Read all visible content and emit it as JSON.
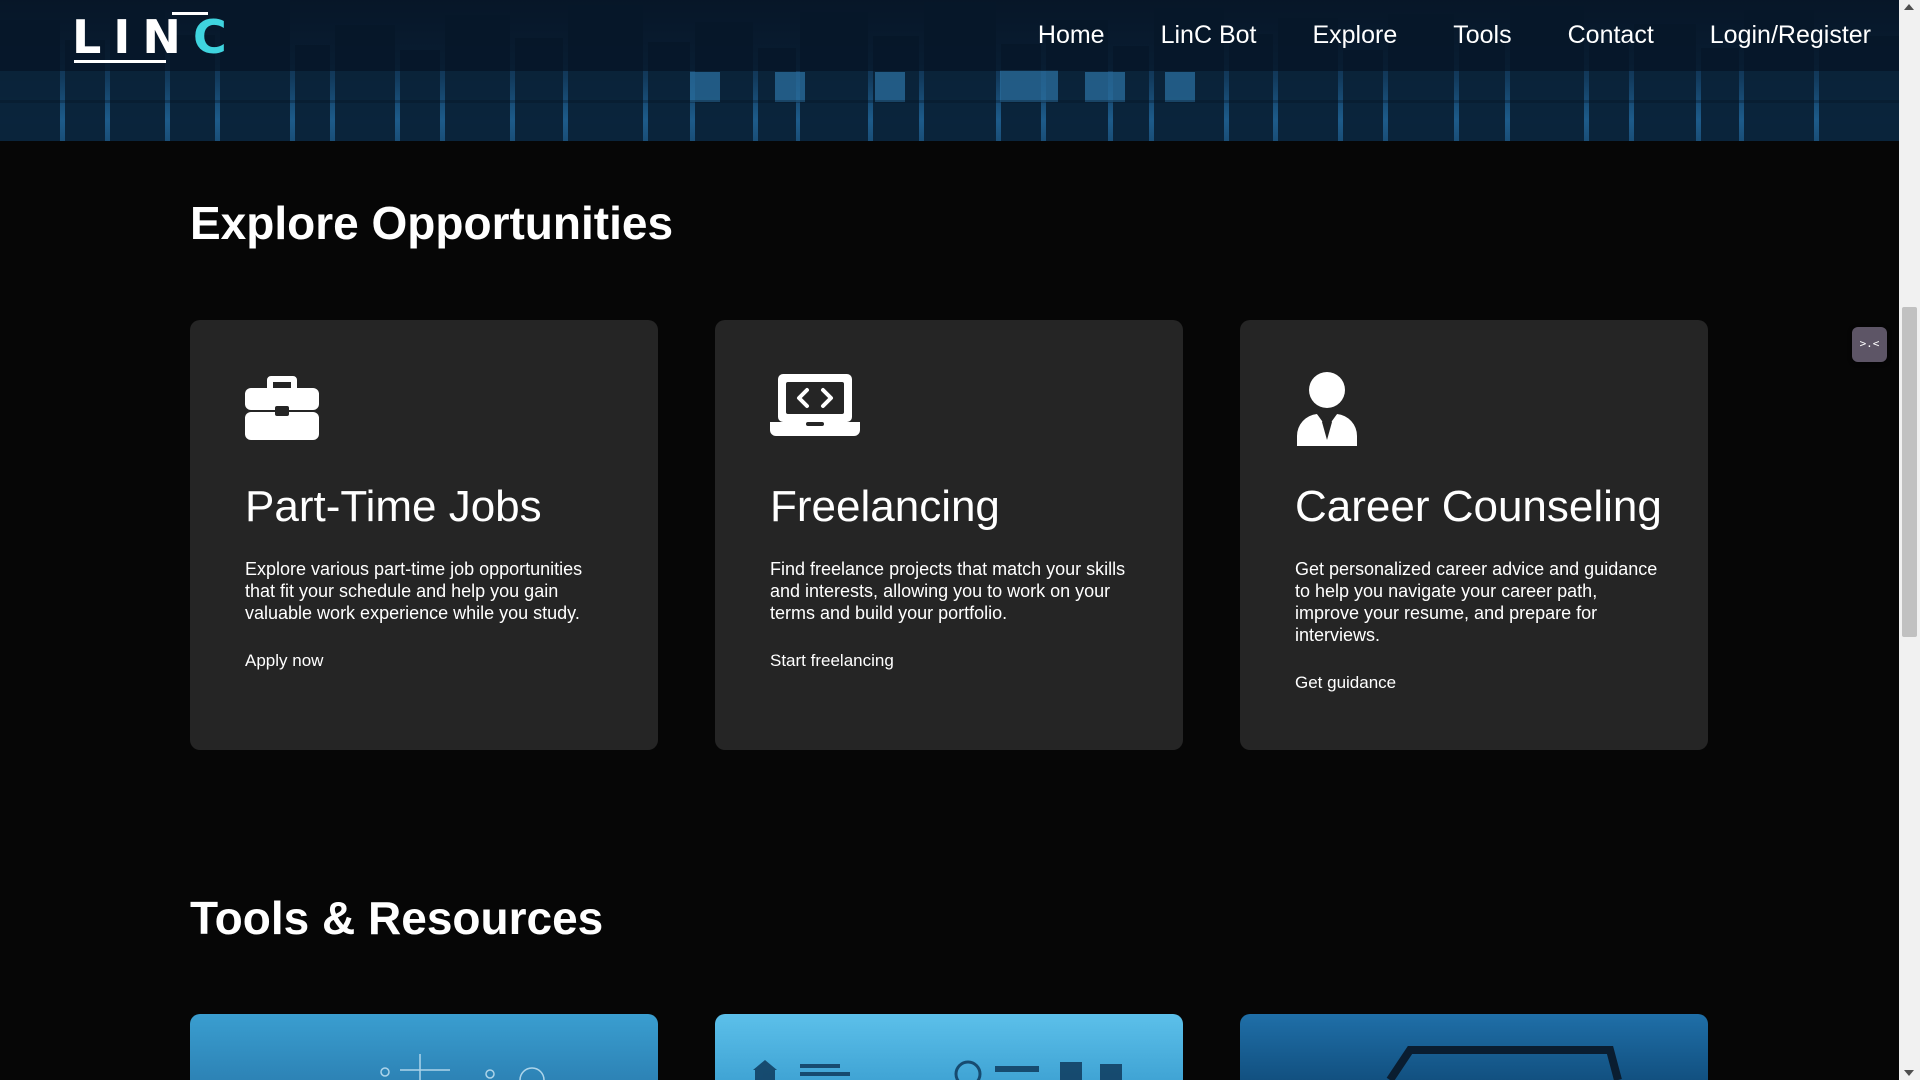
{
  "brand": {
    "logo_text": "LIN",
    "logo_accent": "C",
    "accent_color": "#3fd4df"
  },
  "nav": {
    "items": [
      {
        "label": "Home"
      },
      {
        "label": "LinC Bot"
      },
      {
        "label": "Explore"
      },
      {
        "label": "Tools"
      },
      {
        "label": "Contact"
      },
      {
        "label": "Login/Register"
      }
    ]
  },
  "explore": {
    "title": "Explore Opportunities",
    "cards": [
      {
        "icon": "briefcase-icon",
        "title": "Part-Time Jobs",
        "description": "Explore various part-time job opportunities that fit your schedule and help you gain valuable work experience while you study.",
        "link": "Apply now"
      },
      {
        "icon": "laptop-code-icon",
        "title": "Freelancing",
        "description": "Find freelance projects that match your skills and interests, allowing you to work on your terms and build your portfolio.",
        "link": "Start freelancing"
      },
      {
        "icon": "user-tie-icon",
        "title": "Career Counseling",
        "description": "Get personalized career advice and guidance to help you navigate your career path, improve your resume, and prepare for interviews.",
        "link": "Get guidance"
      }
    ]
  },
  "tools": {
    "title": "Tools & Resources"
  },
  "chat_widget": {
    "label": ">.<"
  },
  "colors": {
    "background": "#060606",
    "card": "#252525",
    "hero": "#123a5c"
  }
}
